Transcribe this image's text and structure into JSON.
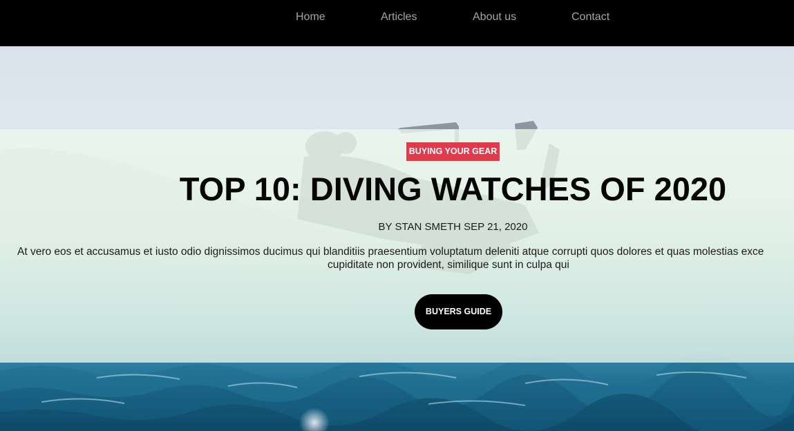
{
  "nav": {
    "items": [
      {
        "label": "Home"
      },
      {
        "label": "Articles"
      },
      {
        "label": "About us"
      },
      {
        "label": "Contact"
      }
    ]
  },
  "article": {
    "category": "BUYING YOUR GEAR",
    "title": "TOP 10: DIVING WATCHES OF 2020",
    "byline": "BY STAN SMETH SEP 21, 2020",
    "excerpt_line1": "At vero eos et accusamus et iusto odio dignissimos ducimus qui blanditiis praesentium voluptatum deleniti atque corrupti quos dolores et quas molestias exce",
    "excerpt_line2": "cupiditate non provident, similique sunt in culpa qui",
    "cta_label": "BUYERS GUIDE"
  },
  "colors": {
    "nav_background": "#000000",
    "nav_text": "#a6a6a6",
    "badge_background": "#e23a4c",
    "panel_tint": "#ecf8ec",
    "cta_background": "#000000"
  }
}
